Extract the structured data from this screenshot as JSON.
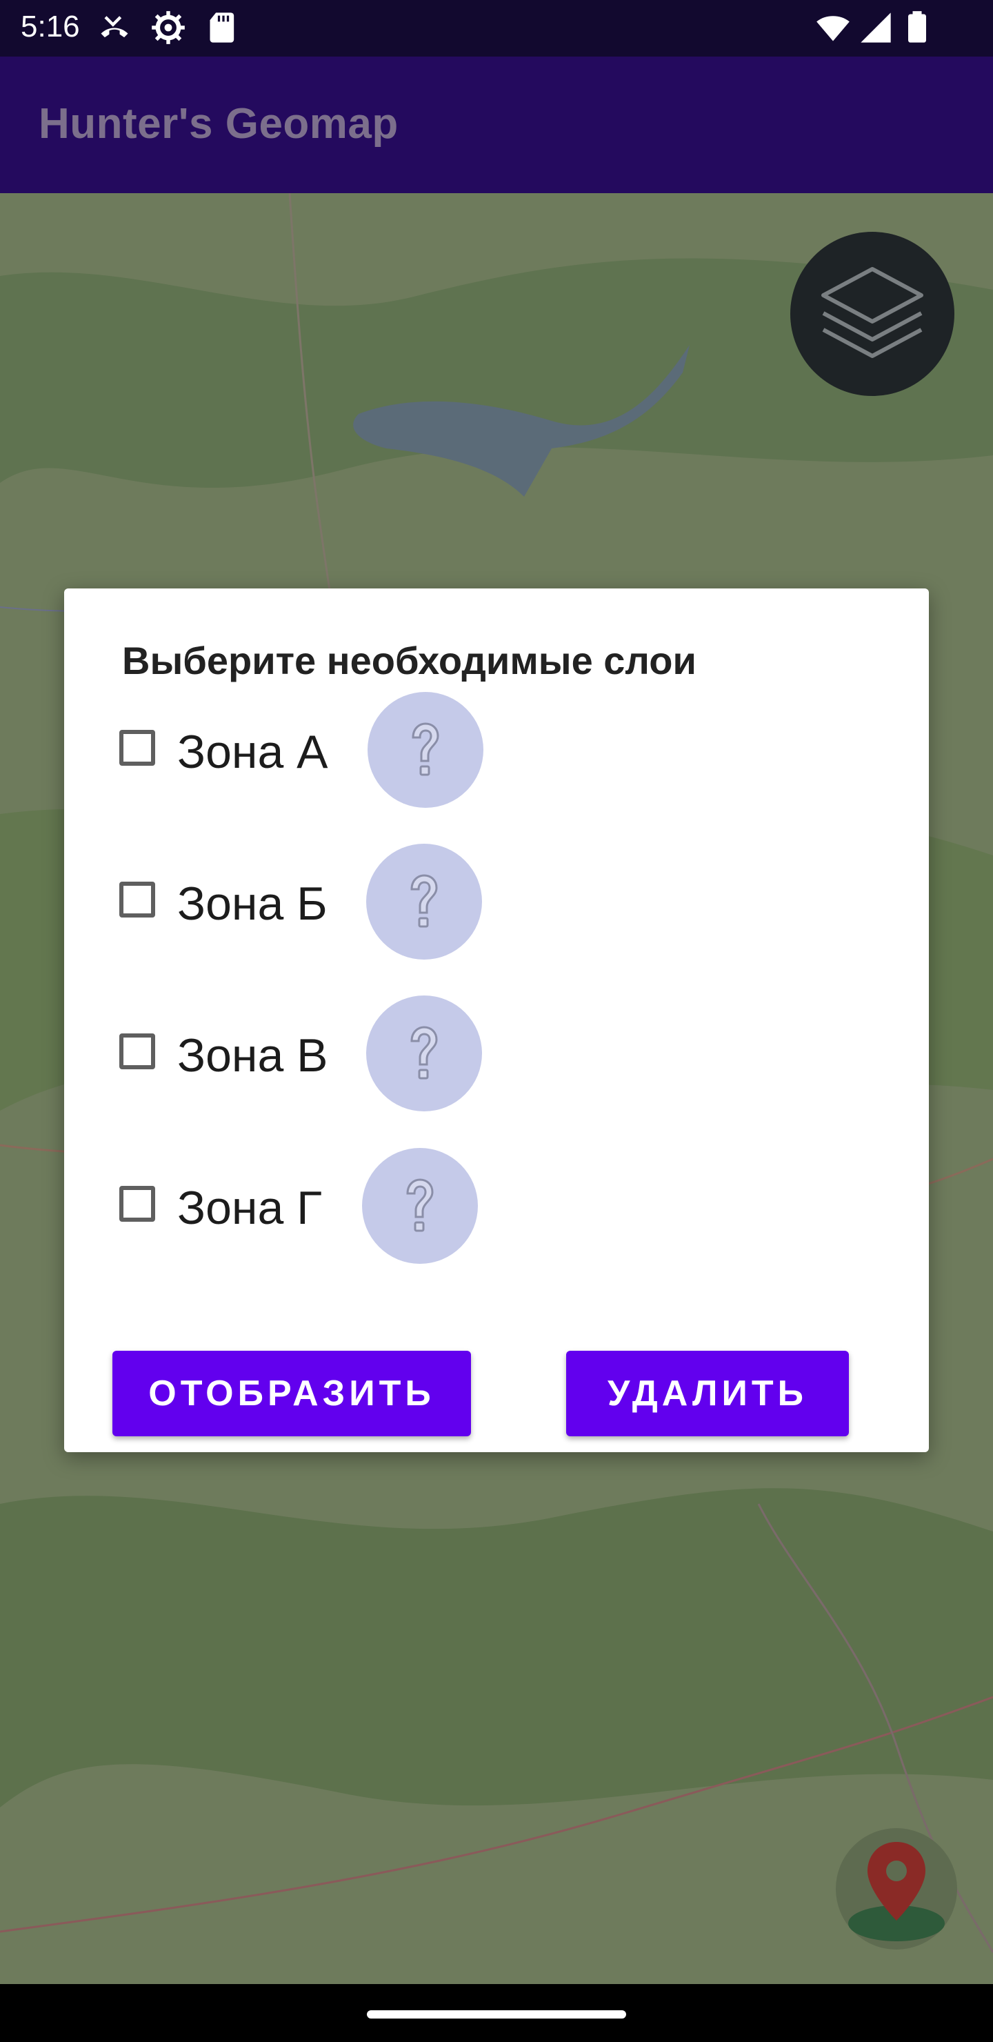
{
  "status_bar": {
    "time": "5:16",
    "icons": [
      "missed-call-icon",
      "settings-icon",
      "sd-card-icon",
      "wifi-icon",
      "signal-icon",
      "battery-icon"
    ]
  },
  "app_bar": {
    "title": "Hunter's Geomap"
  },
  "map": {
    "layers_button_icon": "layers-icon",
    "location_button_icon": "location-pin-icon"
  },
  "dialog": {
    "title": "Выберите необходимые слои",
    "zones": [
      {
        "label": "Зона А",
        "checked": false,
        "help_icon": "question-icon"
      },
      {
        "label": "Зона Б",
        "checked": false,
        "help_icon": "question-icon"
      },
      {
        "label": "Зона В",
        "checked": false,
        "help_icon": "question-icon"
      },
      {
        "label": "Зона Г",
        "checked": false,
        "help_icon": "question-icon"
      }
    ],
    "show_button": "ОТОБРАЗИТЬ",
    "delete_button": "УДАЛИТЬ"
  },
  "colors": {
    "accent": "#6200ee",
    "app_bar": "#240a5e",
    "status_bar": "#12092f",
    "help_circle": "#c5cae9"
  }
}
